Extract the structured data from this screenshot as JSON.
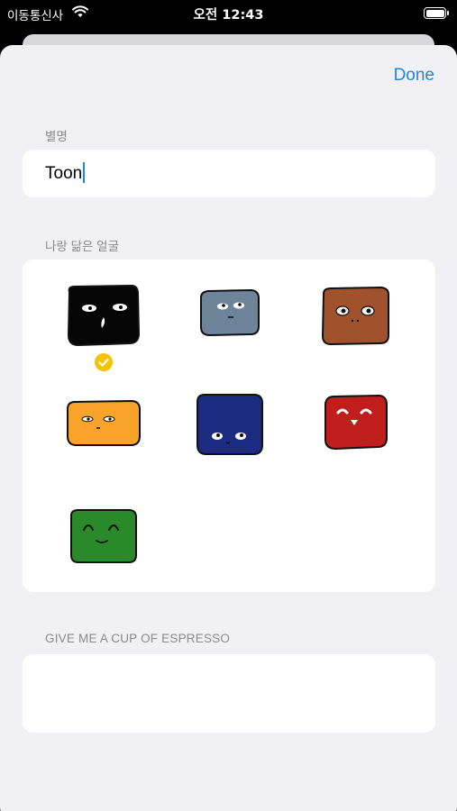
{
  "status_bar": {
    "carrier": "이동통신사",
    "time": "오전 12:43"
  },
  "nav": {
    "done_label": "Done"
  },
  "nickname": {
    "header": "별명",
    "value": "Toon"
  },
  "faces": {
    "header": "나랑 닮은 얼굴",
    "items": [
      {
        "name": "black-face",
        "color": "#050505",
        "selected": true
      },
      {
        "name": "gray-face",
        "color": "#6e8599",
        "selected": false
      },
      {
        "name": "brown-face",
        "color": "#a0522d",
        "selected": false
      },
      {
        "name": "orange-face",
        "color": "#f9a32a",
        "selected": false
      },
      {
        "name": "navy-face",
        "color": "#1c2a80",
        "selected": false
      },
      {
        "name": "red-face",
        "color": "#c01d1d",
        "selected": false
      },
      {
        "name": "green-face",
        "color": "#2a8a2a",
        "selected": false
      }
    ],
    "check_color": "#f5c400"
  },
  "espresso": {
    "header": "GIVE ME A CUP OF ESPRESSO",
    "value": ""
  },
  "colors": {
    "accent": "#1a86e8",
    "background": "#f1f1f5"
  }
}
